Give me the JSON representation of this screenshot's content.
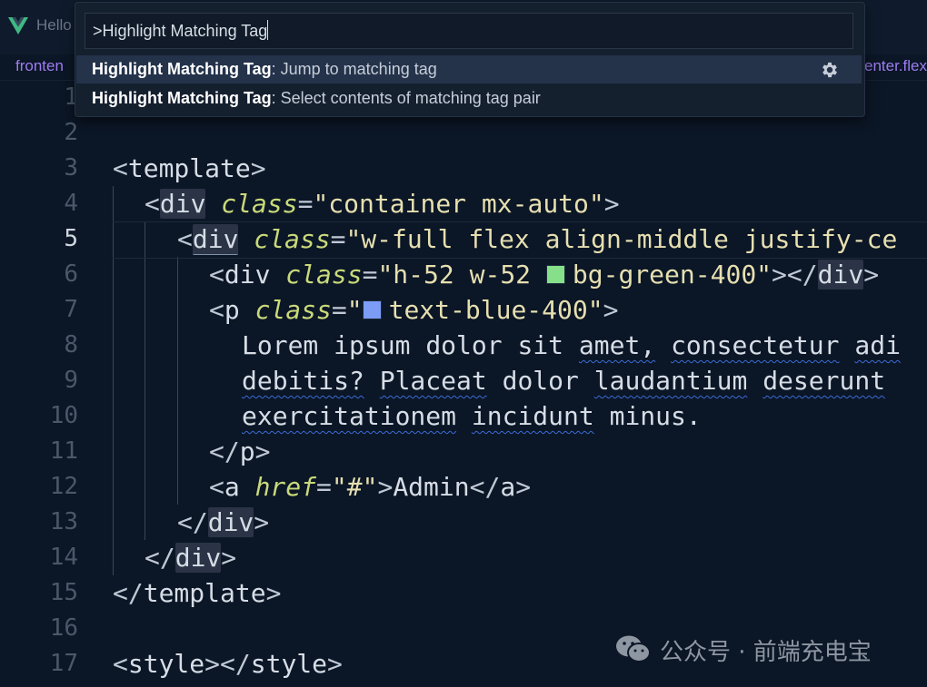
{
  "window": {
    "tab_title": "Hello",
    "breadcrumb_left": "fronten",
    "breadcrumb_right": "enter.flex"
  },
  "palette": {
    "query": ">Highlight Matching Tag",
    "results": [
      {
        "strong": "Highlight Matching Tag",
        "text": ": Jump to matching tag",
        "selected": true
      },
      {
        "strong": "Highlight Matching Tag",
        "text": ": Select contents of matching tag pair",
        "selected": false
      }
    ]
  },
  "editor": {
    "active_line": 5,
    "line_numbers": [
      "1",
      "2",
      "3",
      "4",
      "5",
      "6",
      "7",
      "8",
      "9",
      "10",
      "11",
      "12",
      "13",
      "14",
      "15",
      "16",
      "17"
    ],
    "code": {
      "l3": {
        "open": "<",
        "tag": "template",
        "close": ">"
      },
      "l4": {
        "open": "<",
        "tag": "div",
        "attr": "class",
        "eq": "=",
        "str": "\"container mx-auto\"",
        "close": ">"
      },
      "l5": {
        "open": "<",
        "tag": "div",
        "attr": "class",
        "eq": "=",
        "str": "\"w-full flex align-middle justify-ce"
      },
      "l6": {
        "open": "<",
        "tag": "div",
        "attr": "class",
        "eq": "=",
        "str_a": "\"h-52 w-52 ",
        "str_b": "bg-green-400\"",
        "close": ">",
        "end_open": "</",
        "end_tag": "div",
        "end_close": ">",
        "swatch": "#86e08a"
      },
      "l7": {
        "open": "<",
        "tag": "p",
        "attr": "class",
        "eq": "=",
        "str_a": "\"",
        "str_b": "text-blue-400\"",
        "close": ">",
        "swatch": "#7c9cf6"
      },
      "l8": {
        "w1": "Lorem",
        "w2": "ipsum",
        "w3": "dolor",
        "w4": "sit",
        "w5": "amet,",
        "w6": "consectetur",
        "w7": "adi"
      },
      "l9": {
        "w1": "debitis?",
        "w2": "Placeat",
        "w3": "dolor",
        "w4": "laudantium",
        "w5": "deserunt"
      },
      "l10": {
        "w1": "exercitationem",
        "w2": "incidunt",
        "w3": "minus."
      },
      "l11": {
        "end_open": "</",
        "end_tag": "p",
        "end_close": ">"
      },
      "l12": {
        "open": "<",
        "tag": "a",
        "attr": "href",
        "eq": "=",
        "str": "\"#\"",
        "close": ">",
        "text": "Admin",
        "end_open": "</",
        "end_tag": "a",
        "end_close": ">"
      },
      "l13": {
        "end_open": "</",
        "end_tag": "div",
        "end_close": ">"
      },
      "l14": {
        "end_open": "</",
        "end_tag": "div",
        "end_close": ">"
      },
      "l15": {
        "end_open": "</",
        "end_tag": "template",
        "end_close": ">"
      },
      "l17": {
        "open": "<",
        "tag": "style",
        "close": ">",
        "end_open": "</",
        "end_tag": "style",
        "end_close": ">"
      }
    }
  },
  "watermark": {
    "text": "公众号 · 前端充电宝"
  },
  "colors": {
    "background": "#0b1626",
    "attr": "#c9d97a",
    "string": "#e6dfb0",
    "accent_purple": "#9d7df0"
  }
}
